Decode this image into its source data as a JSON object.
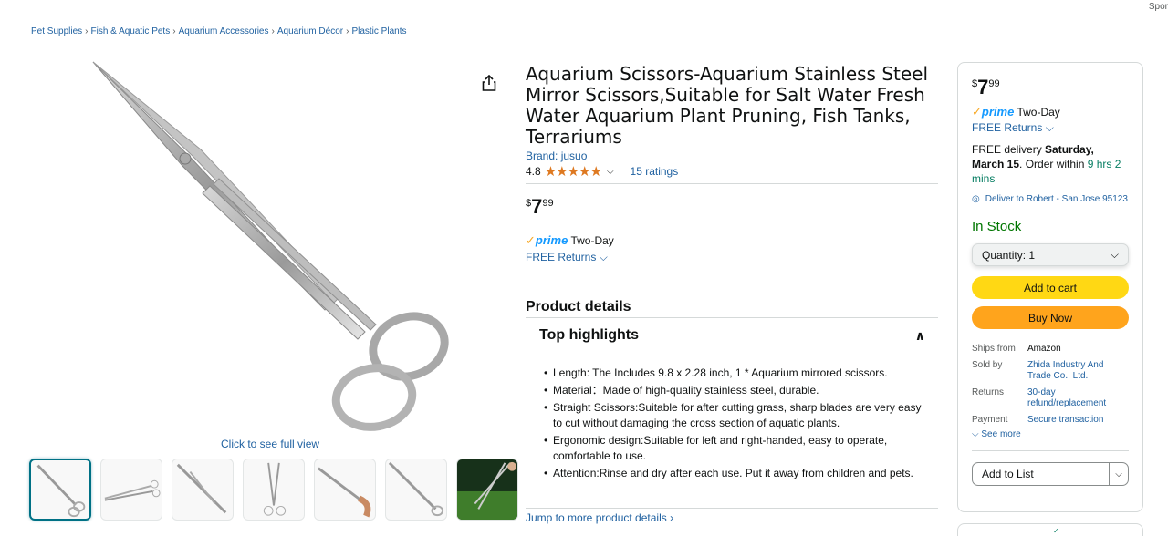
{
  "sponsored": "Spor",
  "breadcrumb": [
    "Pet Supplies",
    "Fish & Aquatic Pets",
    "Aquarium Accessories",
    "Aquarium Décor",
    "Plastic Plants"
  ],
  "breadcrumb_sep": "›",
  "media": {
    "click_full_view": "Click to see full view",
    "thumbnail_count": 7
  },
  "product": {
    "title": "Aquarium Scissors-Aquarium Stainless Steel Mirror Scissors,Suitable for Salt Water Fresh Water Aquarium Plant Pruning, Fish Tanks, Terrariums",
    "brand": "Brand: jusuo",
    "rating_value": "4.8",
    "stars": "★★★★★",
    "ratings_count": "15 ratings",
    "price_currency": "$",
    "price_whole": "7",
    "price_fraction": "99",
    "prime_check": "✓",
    "prime_label": "prime",
    "prime_speed": "Two-Day",
    "free_returns": "FREE Returns"
  },
  "details": {
    "heading": "Product details",
    "highlights_heading": "Top highlights",
    "bullets": [
      "Length: The Includes 9.8 x 2.28 inch, 1 * Aquarium mirrored scissors.",
      "Material：Made of high-quality stainless steel, durable.",
      "Straight Scissors:Suitable for after cutting grass, sharp blades are very easy to cut without damaging the cross section of aquatic plants.",
      "Ergonomic design:Suitable for left and right-handed, easy to operate, comfortable to use.",
      "Attention:Rinse and dry after each use. Put it away from children and pets."
    ],
    "jump_link": "Jump to more product details ›"
  },
  "buybox": {
    "price_currency": "$",
    "price_whole": "7",
    "price_fraction": "99",
    "prime_label": "prime",
    "prime_speed": "Two-Day",
    "free_returns": "FREE Returns",
    "delivery_prefix": "FREE delivery ",
    "delivery_date": "Saturday, March 15",
    "delivery_mid": ". Order within ",
    "delivery_countdown": "9 hrs 2 mins",
    "deliver_to": "Deliver to Robert - San Jose 95123",
    "stock": "In Stock",
    "quantity_label": "Quantity: 1",
    "add_to_cart": "Add to cart",
    "buy_now": "Buy Now",
    "info": [
      {
        "key": "Ships from",
        "value": "Amazon",
        "link": false
      },
      {
        "key": "Sold by",
        "value": "Zhida Industry And Trade Co., Ltd.",
        "link": true
      },
      {
        "key": "Returns",
        "value": "30-day refund/replacement",
        "link": true
      },
      {
        "key": "Payment",
        "value": "Secure transaction",
        "link": true
      }
    ],
    "see_more": "See more",
    "add_to_list": "Add to List"
  },
  "colors": {
    "link": "#2162a1",
    "cart_button": "#ffd814",
    "buy_button": "#ffa41c",
    "star": "#de7921",
    "in_stock": "#007600",
    "prime": "#1399ff"
  }
}
